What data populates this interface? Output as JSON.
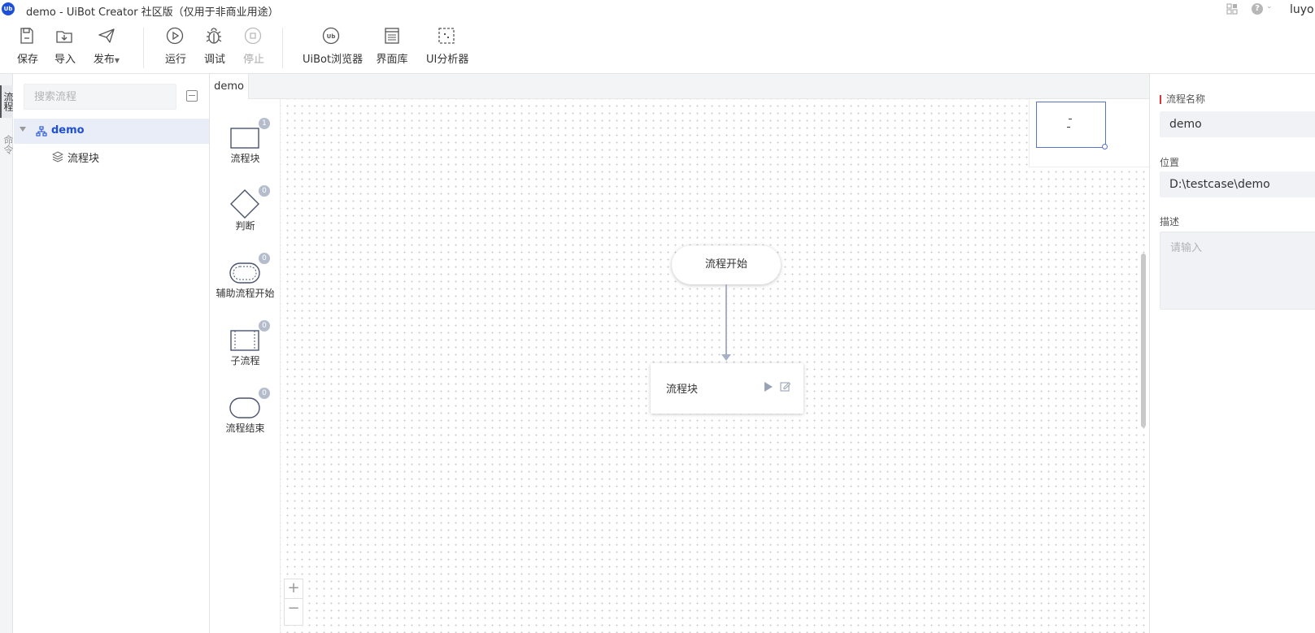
{
  "window": {
    "title": "demo - UiBot Creator 社区版（仅用于非商业用途）",
    "logo_text": "Ub",
    "help_glyph": "?",
    "username": "luyo"
  },
  "toolbar": {
    "save": "保存",
    "import": "导入",
    "publish": "发布",
    "run": "运行",
    "debug": "调试",
    "stop": "停止",
    "browser": "UiBot浏览器",
    "ui_library": "界面库",
    "ui_analyzer": "UI分析器"
  },
  "left_tabs": {
    "flow": "流程",
    "other": "命令"
  },
  "tree": {
    "search_placeholder": "搜索流程",
    "root": "demo",
    "children": [
      "流程块"
    ]
  },
  "editor": {
    "tab": "demo"
  },
  "palette": [
    {
      "label": "流程块",
      "count": "1"
    },
    {
      "label": "判断",
      "count": "0"
    },
    {
      "label": "辅助流程开始",
      "count": "0"
    },
    {
      "label": "子流程",
      "count": "0"
    },
    {
      "label": "流程结束",
      "count": "0"
    }
  ],
  "canvas": {
    "start_node": "流程开始",
    "block_node": "流程块",
    "zoom_in": "+",
    "zoom_out": "−"
  },
  "properties": {
    "name_label": "流程名称",
    "name_value": "demo",
    "location_label": "位置",
    "location_value": "D:\\testcase\\demo",
    "description_label": "描述",
    "description_placeholder": "请输入"
  },
  "colors": {
    "accent": "#1f4fd2",
    "required_marker": "#e3303d",
    "connector": "#a7b1c6"
  }
}
